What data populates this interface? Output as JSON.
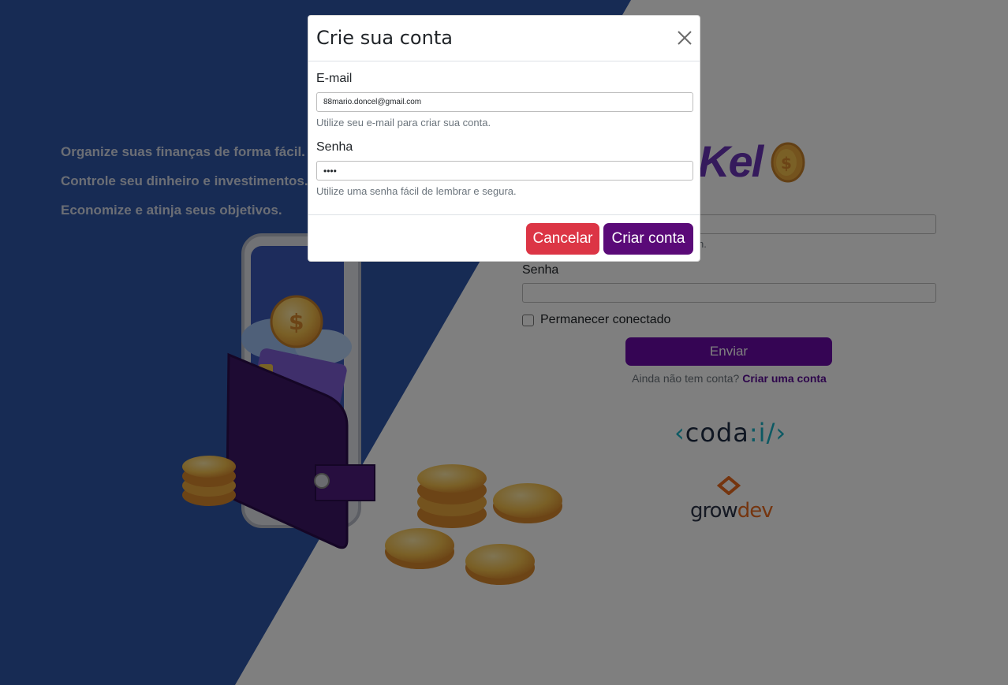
{
  "background": {
    "colors": {
      "left_panel": "#2f57a8",
      "right_panel": "#ffffff",
      "accent": "#6a0aa8"
    },
    "taglines": [
      "Organize suas finanças de forma fácil.",
      "Controle seu dinheiro e investimentos.",
      "Economize e atinja seus objetivos."
    ],
    "logo_text": "Kel",
    "login": {
      "email_hint_fragment": "n.",
      "password_label": "Senha",
      "remember_label": "Permanecer conectado",
      "remember_checked": false,
      "send_button": "Enviar",
      "no_account_text": "Ainda não tem conta?",
      "create_account_link": "Criar uma conta"
    },
    "partners": {
      "coda": {
        "open": "‹",
        "text": "coda",
        "mid": ":",
        "slash": "i/",
        "close": "›"
      },
      "growdev": {
        "part1": "grow",
        "part2": "dev"
      }
    }
  },
  "modal": {
    "title": "Crie sua conta",
    "close_icon": "close-icon",
    "email": {
      "label": "E-mail",
      "value": "88mario.doncel@gmail.com",
      "hint": "Utilize seu e-mail para criar sua conta."
    },
    "password": {
      "label": "Senha",
      "value": "••••",
      "hint": "Utilize uma senha fácil de lembrar e segura."
    },
    "buttons": {
      "cancel": "Cancelar",
      "create": "Criar conta"
    },
    "colors": {
      "cancel": "#dc3545",
      "create": "#5a0a78"
    }
  }
}
